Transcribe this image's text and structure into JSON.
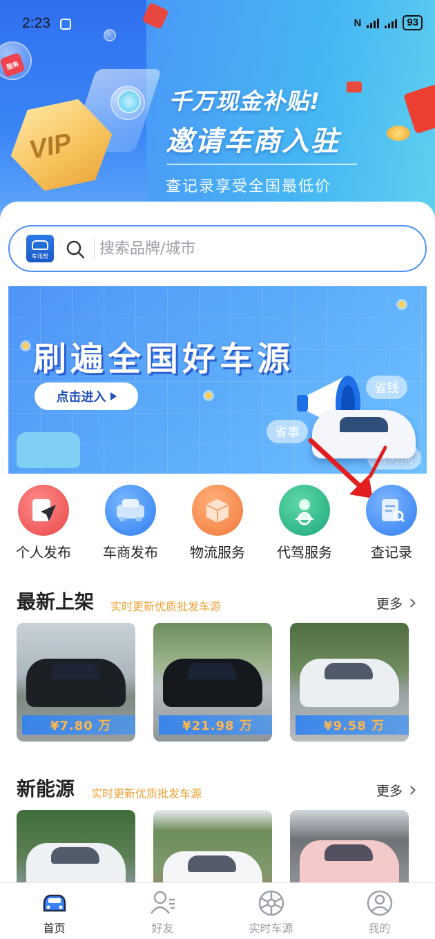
{
  "status_bar": {
    "time": "2:23",
    "battery": "93"
  },
  "hero": {
    "vip_text": "VIP",
    "tag_text": "服务",
    "headline_1": "千万现金补贴!",
    "headline_2": "邀请车商入驻",
    "subline": "查记录享受全国最低价"
  },
  "search": {
    "logo_text": "车讯帮",
    "placeholder": "搜索品牌/城市"
  },
  "banner": {
    "title": "刷遍全国好车源",
    "button": "点击进入",
    "tags": [
      "省钱",
      "省事",
      "省时间"
    ]
  },
  "services": [
    {
      "label": "个人发布",
      "icon": "personal-publish-icon",
      "color": "#ef5b5b"
    },
    {
      "label": "车商发布",
      "icon": "dealer-publish-icon",
      "color": "#3b8cf6"
    },
    {
      "label": "物流服务",
      "icon": "logistics-icon",
      "color": "#f58a42"
    },
    {
      "label": "代驾服务",
      "icon": "driver-service-icon",
      "color": "#27b384"
    },
    {
      "label": "查记录",
      "icon": "check-records-icon",
      "color": "#3f8ef7"
    }
  ],
  "latest": {
    "title": "最新上架",
    "subtitle": "实时更新优质批发车源",
    "more": "更多",
    "cards": [
      {
        "price": "¥7.80 万"
      },
      {
        "price": "¥21.98 万"
      },
      {
        "price": "¥9.58 万"
      }
    ]
  },
  "new_energy": {
    "title": "新能源",
    "subtitle": "实时更新优质批发车源",
    "more": "更多"
  },
  "tabbar": [
    {
      "label": "首页",
      "icon": "car-home-icon",
      "active": true
    },
    {
      "label": "好友",
      "icon": "friends-icon",
      "active": false
    },
    {
      "label": "实时车源",
      "icon": "wheel-icon",
      "active": false
    },
    {
      "label": "我的",
      "icon": "profile-icon",
      "active": false
    }
  ],
  "colors": {
    "accent": "#3b82f6",
    "subtitle_orange": "#f0a033",
    "price_orange": "#ffb74a"
  }
}
